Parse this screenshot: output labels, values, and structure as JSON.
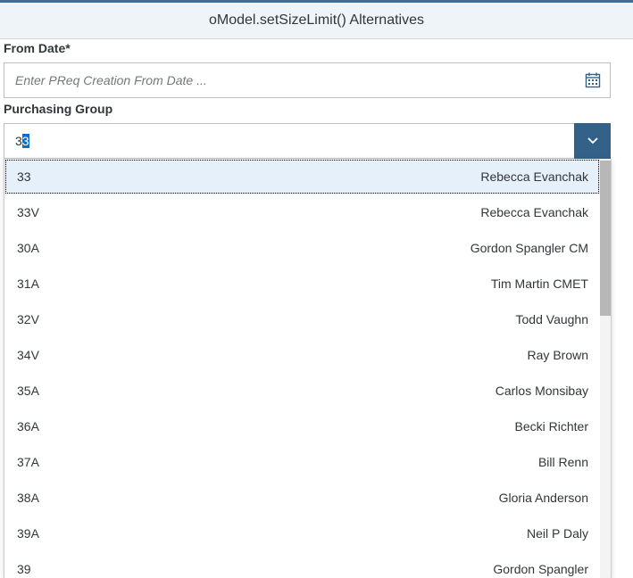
{
  "header": {
    "title": "oModel.setSizeLimit() Alternatives"
  },
  "from_date": {
    "label": "From Date*",
    "placeholder": "Enter PReq Creation From Date ..."
  },
  "purchasing_group": {
    "label": "Purchasing Group",
    "typed": "3",
    "selected_suffix": "3"
  },
  "options": [
    {
      "code": "33",
      "name": "Rebecca Evanchak"
    },
    {
      "code": "33V",
      "name": "Rebecca Evanchak"
    },
    {
      "code": "30A",
      "name": "Gordon Spangler CM"
    },
    {
      "code": "31A",
      "name": "Tim Martin CMET"
    },
    {
      "code": "32V",
      "name": "Todd Vaughn"
    },
    {
      "code": "34V",
      "name": "Ray Brown"
    },
    {
      "code": "35A",
      "name": "Carlos Monsibay"
    },
    {
      "code": "36A",
      "name": "Becki Richter"
    },
    {
      "code": "37A",
      "name": "Bill Renn"
    },
    {
      "code": "38A",
      "name": "Gloria Anderson"
    },
    {
      "code": "39A",
      "name": "Neil P Daly"
    },
    {
      "code": "39",
      "name": "Gordon Spangler"
    }
  ],
  "colors": {
    "accent": "#346187",
    "header_bg": "#eff4f9",
    "selection": "#0a6ed1"
  },
  "icons": {
    "date_picker": "calendar-icon",
    "combo_arrow": "chevron-down-icon"
  }
}
